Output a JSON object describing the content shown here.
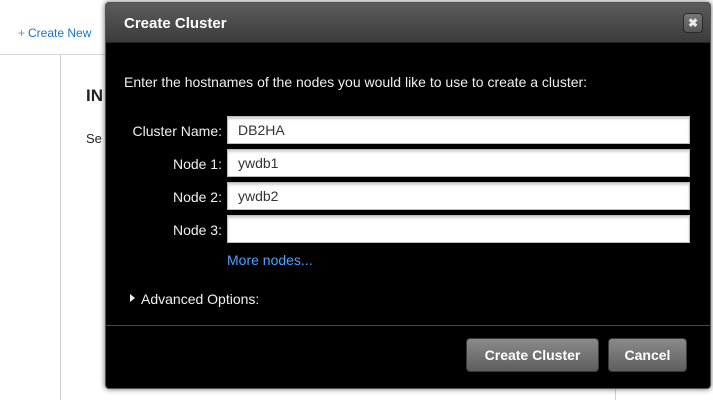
{
  "background": {
    "create_new": "Create New",
    "heading_fragment": "IN",
    "text_fragment": "Se"
  },
  "dialog": {
    "title": "Create Cluster",
    "close_glyph": "✖",
    "intro": "Enter the hostnames of the nodes you would like to use to create a cluster:",
    "fields": [
      {
        "label": "Cluster Name:",
        "value": "DB2HA"
      },
      {
        "label": "Node 1:",
        "value": "ywdb1"
      },
      {
        "label": "Node 2:",
        "value": "ywdb2"
      },
      {
        "label": "Node 3:",
        "value": ""
      }
    ],
    "more_nodes": "More nodes...",
    "advanced_options": "Advanced Options:",
    "buttons": {
      "create": "Create Cluster",
      "cancel": "Cancel"
    }
  },
  "colors": {
    "link": "#1a73c8",
    "dialog_link": "#4da3ff",
    "dialog_bg": "#000000"
  },
  "icons": {
    "close": "close-icon",
    "plus": "plus-icon",
    "expand": "triangle-right-icon"
  }
}
